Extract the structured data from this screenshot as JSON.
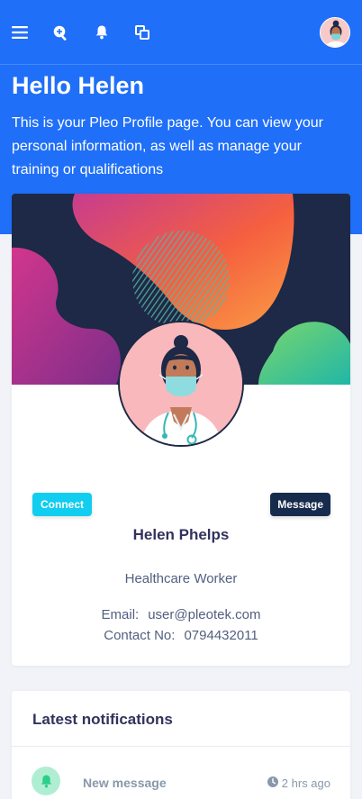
{
  "colors": {
    "primary": "#1f6ff8",
    "info": "#11cdef",
    "dark": "#172b4d",
    "success_soft": "#b0eed3"
  },
  "topbar": {
    "icons": [
      "menu-icon",
      "search-zoom-icon",
      "bell-icon",
      "windows-icon"
    ]
  },
  "header": {
    "greeting": "Hello Helen",
    "intro": "This is your Pleo Profile page. You can view your personal information, as well as manage your training or qualifications"
  },
  "profile": {
    "connect_label": "Connect",
    "message_label": "Message",
    "name": "Helen Phelps",
    "role": "Healthcare Worker",
    "email_label": "Email:",
    "email": "user@pleotek.com",
    "contact_label": "Contact No:",
    "contact": "0794432011"
  },
  "notifications": {
    "title": "Latest notifications",
    "items": [
      {
        "text": "New message",
        "time": "2 hrs ago",
        "icon": "bell-icon"
      }
    ]
  }
}
